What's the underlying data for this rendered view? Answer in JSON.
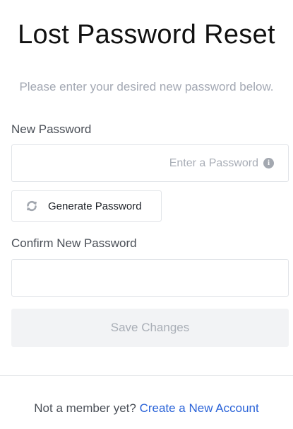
{
  "header": {
    "title": "Lost Password Reset",
    "subtitle": "Please enter your desired new password below."
  },
  "form": {
    "new_password_label": "New Password",
    "new_password_placeholder": "Enter a Password",
    "new_password_value": "",
    "info_icon": "info-icon",
    "generate_button_label": "Generate Password",
    "generate_icon": "refresh-icon",
    "confirm_password_label": "Confirm New Password",
    "confirm_password_value": "",
    "save_button_label": "Save Changes"
  },
  "footer": {
    "prompt_text": "Not a member yet?",
    "link_text": "Create a New Account"
  },
  "colors": {
    "link": "#2a63d8",
    "muted_text": "#a3a8b3",
    "disabled_button_bg": "#f2f3f5"
  }
}
